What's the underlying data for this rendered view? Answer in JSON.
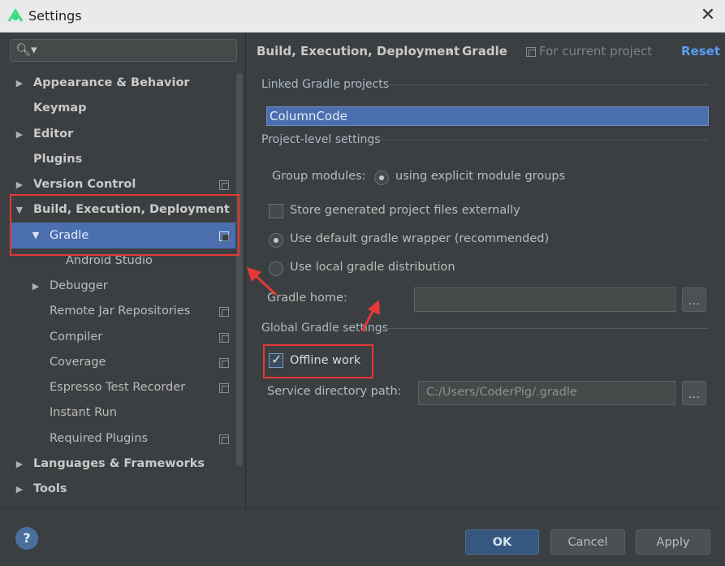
{
  "window": {
    "title": "Settings"
  },
  "search": {
    "placeholder": ""
  },
  "sidebar": {
    "items": [
      {
        "label": "Appearance & Behavior"
      },
      {
        "label": "Keymap"
      },
      {
        "label": "Editor"
      },
      {
        "label": "Plugins"
      },
      {
        "label": "Version Control"
      },
      {
        "label": "Build, Execution, Deployment"
      },
      {
        "label": "Gradle"
      },
      {
        "label": "Android Studio"
      },
      {
        "label": "Debugger"
      },
      {
        "label": "Remote Jar Repositories"
      },
      {
        "label": "Compiler"
      },
      {
        "label": "Coverage"
      },
      {
        "label": "Espresso Test Recorder"
      },
      {
        "label": "Instant Run"
      },
      {
        "label": "Required Plugins"
      },
      {
        "label": "Languages & Frameworks"
      },
      {
        "label": "Tools"
      }
    ]
  },
  "breadcrumb": {
    "parent": "Build, Execution, Deployment",
    "separator": "›",
    "current": "Gradle",
    "scope": "For current project",
    "reset": "Reset"
  },
  "linked": {
    "section": "Linked Gradle projects",
    "projects": [
      "ColumnCode"
    ]
  },
  "project_settings": {
    "section": "Project-level settings",
    "group_modules_label": "Group modules:",
    "group_modules_value": "using explicit module groups",
    "store_external": {
      "label": "Store generated project files externally",
      "checked": false
    },
    "default_wrapper": {
      "label": "Use default gradle wrapper (recommended)",
      "selected": true
    },
    "local_distribution": {
      "label": "Use local gradle distribution",
      "selected": false
    },
    "gradle_home_label": "Gradle home:",
    "gradle_home_value": "",
    "browse": "..."
  },
  "global_settings": {
    "section": "Global Gradle settings",
    "offline_work": {
      "label": "Offline work",
      "checked": true
    },
    "service_dir_label": "Service directory path:",
    "service_dir_value": "C:/Users/CoderPig/.gradle",
    "browse": "..."
  },
  "footer": {
    "help": "?",
    "ok": "OK",
    "cancel": "Cancel",
    "apply": "Apply"
  },
  "colors": {
    "accent": "#4b6eaf",
    "annotation": "#e53935",
    "link": "#589df6"
  }
}
